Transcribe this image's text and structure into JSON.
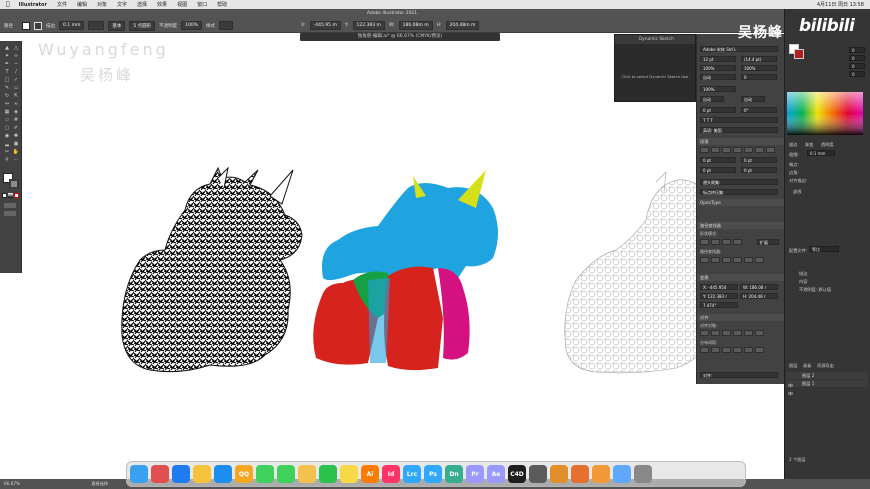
{
  "menubar": {
    "app_name": "Illustrator",
    "items": [
      "文件",
      "编辑",
      "对象",
      "文字",
      "选择",
      "效果",
      "视图",
      "窗口",
      "帮助"
    ],
    "right_status": "4月11日 周日 13:58"
  },
  "controlbar": {
    "window_title": "Adobe Illustrator 2021",
    "fill_label": "描边",
    "stroke_value": "0.1 mm",
    "brush_label": "基本",
    "style_label": "5 点圆形",
    "opacity_label": "不透明度",
    "opacity_value": "100%",
    "style2": "样式",
    "x_value": "-445.95 m",
    "y_value": "122.383 m",
    "w_value": "186.08m m",
    "h_value": "204.48m m"
  },
  "doc_tab": "独角兽-编辑.ai* @ 66.67% (CMYK/预览)",
  "watermark": {
    "name_en": "Wuyangfeng",
    "name_cn": "吴杨峰"
  },
  "brand": {
    "cn": "吴杨峰",
    "bili": "bilibili"
  },
  "dynamic_sketch": {
    "tab": "Dynamic Sketch",
    "message": "Click to select Dynamic Sketch tool"
  },
  "props_panel": {
    "font_family": "Adobe 宋体 Std L",
    "font_size": "12 pt",
    "leading": "(14.4 pt)",
    "tracking": "100%",
    "kerning": "自动",
    "scale_v": "100%",
    "scale_h": "0",
    "baseline": "0 pt",
    "rotate": "0°",
    "section_char": "字符",
    "section_para": "段落",
    "section_opentype": "OpenType",
    "lang": "英语: 美国",
    "x_label": "X: -445.954",
    "y_label": "Y: 122.383 r",
    "w_label": "W: 186.08 r",
    "h_label": "H: 204.48 r",
    "angle": "7.474°",
    "section_align": "对齐",
    "section_pathfinder": "路径查找器",
    "section_shape_modes": "形状模式:",
    "section_pathfinders": "路径查找器:",
    "expand_button": "扩展",
    "section_transform": "变换",
    "align_to": "对齐对象:",
    "distribute": "分布间距:"
  },
  "right_panel": {
    "tabs": [
      "颜色",
      "色板",
      "画笔"
    ],
    "stroke_tabs": [
      "描边",
      "渐变",
      "透明度"
    ],
    "weight_label": "粗细:",
    "weight_value": "0.1 mm",
    "cap_label": "端点:",
    "corner_label": "边角:",
    "align_label": "对齐描边:",
    "dashed_label": "虚线",
    "profile_label": "配置文件:",
    "profile_value": "等比",
    "appearance_items": [
      "描边",
      "内容",
      "不透明度: 默认值"
    ],
    "layer_tabs": [
      "图层",
      "画板",
      "资源导出"
    ],
    "layers": [
      "图层 2",
      "图层 1"
    ],
    "layers_count": "2 个图层"
  },
  "status": {
    "zoom": "66.67%",
    "mode": "直接选择"
  },
  "dock": {
    "apps": [
      "Finder",
      "Launchpad",
      "App Store",
      "Chrome",
      "Safari",
      "QQ",
      "Messages",
      "FaceTime",
      "Photos",
      "WeChat",
      "Notes",
      "Ai",
      "Id",
      "Lrc",
      "Ps",
      "Dn",
      "Pr",
      "Ae",
      "C4D",
      "Resolve",
      "ZBrush",
      "Blender",
      "Pages",
      "Preview",
      "Trash"
    ],
    "colors": [
      "#3aa0f0",
      "#e05050",
      "#1e7bf0",
      "#f5c33b",
      "#1c8ef0",
      "#f5a623",
      "#3fd15c",
      "#3fd15c",
      "#f2c14e",
      "#2bc14b",
      "#f8d849",
      "#ff7c00",
      "#ff3366",
      "#31a8ff",
      "#31a8ff",
      "#36ad8f",
      "#9999ff",
      "#9999ff",
      "#1e1e1e",
      "#5b5b5b",
      "#e08f2a",
      "#e6702e",
      "#f29a3a",
      "#5fa8ff",
      "#888888"
    ]
  },
  "artwork": {
    "colors": {
      "blue": "#20a4e0",
      "red": "#d7231e",
      "green": "#16a044",
      "magenta": "#d4117f",
      "yellow": "#d6e01a"
    }
  }
}
